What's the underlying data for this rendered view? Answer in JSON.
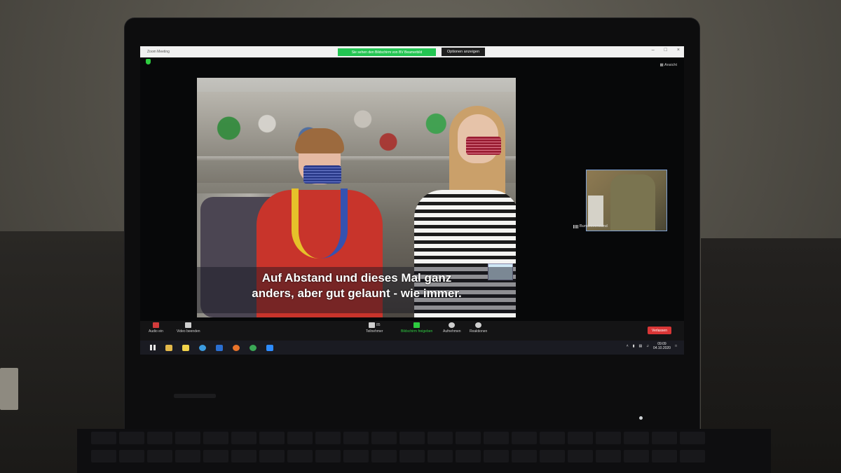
{
  "zoom": {
    "window_title": "Zoom Meeting",
    "share_banner": "Sie sehen den Bildschirm von BV Beamerbild",
    "options_button": "Optionen anzeigen",
    "view_button": "Ansicht",
    "subtitle_line1": "Auf Abstand und dieses Mal ganz",
    "subtitle_line2": "anders, aber gut gelaunt - wie immer.",
    "participant_name": "Bundesvorstand",
    "toolbar": {
      "audio": "Audio ein",
      "video": "Video beenden",
      "participants": "Teilnehmer",
      "participants_count": "85",
      "share": "Bildschirm freigeben",
      "record": "Aufnehmen",
      "reactions": "Reaktionen",
      "leave": "Verlassen"
    },
    "colors": {
      "share_green": "#23c552",
      "leave_red": "#d93636"
    }
  },
  "taskbar": {
    "time": "09:09",
    "date": "04.10.2020",
    "apps": [
      "windows-start-icon",
      "file-explorer-icon",
      "media-icon",
      "edge-icon",
      "mail-icon",
      "firefox-icon",
      "chrome-icon",
      "zoom-icon"
    ]
  }
}
